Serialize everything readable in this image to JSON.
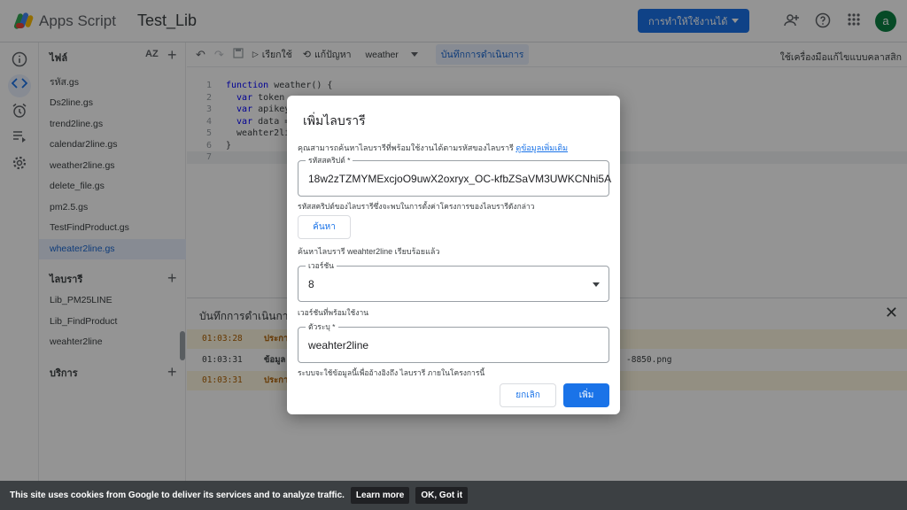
{
  "header": {
    "app_name": "Apps Script",
    "project_name": "Test_Lib",
    "deploy_label": "การทำให้ใช้งานได้",
    "avatar_letter": "a",
    "accent_color": "#1a73e8"
  },
  "files_panel": {
    "title": "ไฟล์",
    "sort_label": "AZ",
    "files": [
      {
        "name": "รหัส.gs"
      },
      {
        "name": "Ds2line.gs"
      },
      {
        "name": "trend2line.gs"
      },
      {
        "name": "calendar2line.gs"
      },
      {
        "name": "weather2line.gs"
      },
      {
        "name": "delete_file.gs"
      },
      {
        "name": "pm2.5.gs"
      },
      {
        "name": "TestFindProduct.gs"
      },
      {
        "name": "wheater2line.gs"
      }
    ],
    "libraries_title": "ไลบรารี",
    "libraries": [
      {
        "name": "Lib_PM25LINE"
      },
      {
        "name": "Lib_FindProduct"
      },
      {
        "name": "weahter2line"
      }
    ],
    "services_title": "บริการ"
  },
  "toolbar": {
    "run_label": "เรียกใช้",
    "debug_label": "แก้ปัญหา",
    "function_name": "weather",
    "exec_log_label": "บันทึกการดำเนินการ",
    "debugger_link": "ใช้เครื่องมือแก้ไขแบบคลาสสิก"
  },
  "code": {
    "lines": [
      {
        "num": "1",
        "kw": "function",
        "text": " weather() {"
      },
      {
        "num": "2",
        "kw": "  var",
        "text": " token"
      },
      {
        "num": "3",
        "kw": "  var",
        "text": " apikey"
      },
      {
        "num": "4",
        "kw": "  var",
        "text": " data ="
      },
      {
        "num": "5",
        "kw": "",
        "text": "  weahter2lib"
      },
      {
        "num": "6",
        "kw": "",
        "text": "}"
      },
      {
        "num": "7",
        "kw": "",
        "text": ""
      }
    ]
  },
  "log_panel": {
    "title": "บันทึกการดำเนินการ",
    "rows": [
      {
        "time": "01:03:28",
        "level": "ประกาศ",
        "msg": "",
        "warn": true
      },
      {
        "time": "01:03:31",
        "level": "ข้อมูล",
        "msg": "-8850.png",
        "warn": false
      },
      {
        "time": "01:03:31",
        "level": "ประกาศ",
        "msg": "",
        "warn": true
      }
    ]
  },
  "dialog": {
    "title": "เพิ่มไลบรารี",
    "description": "คุณสามารถค้นหาไลบรารีที่พร้อมใช้งานได้ตามรหัสของไลบรารี",
    "learn_more": "ดูข้อมูลเพิ่มเติม",
    "script_id_label": "รหัสสคริปต์ *",
    "script_id_value": "18w2zTZMYMExcjoO9uwX2oxryx_OC-kfbZSaVM3UWKCNhi5A",
    "script_id_helper": "รหัสสคริปต์ของไลบรารีซึ่งจะพบในการตั้งค่าโครงการของไลบรารีดังกล่าว",
    "lookup_label": "ค้นหา",
    "found_text": "ค้นหาไลบรารี weahter2line เรียบร้อยแล้ว",
    "version_label": "เวอร์ชัน",
    "version_value": "8",
    "version_helper": "เวอร์ชันที่พร้อมใช้งาน",
    "identifier_label": "ตัวระบุ *",
    "identifier_value": "weahter2line",
    "identifier_helper": "ระบบจะใช้ข้อมูลนี้เพื่ออ้างอิงถึง ไลบรารี ภายในโครงการนี้",
    "cancel_label": "ยกเลิก",
    "add_label": "เพิ่ม"
  },
  "cookie_bar": {
    "text": "This site uses cookies from Google to deliver its services and to analyze traffic.",
    "learn_more": "Learn more",
    "ok": "OK, Got it"
  }
}
